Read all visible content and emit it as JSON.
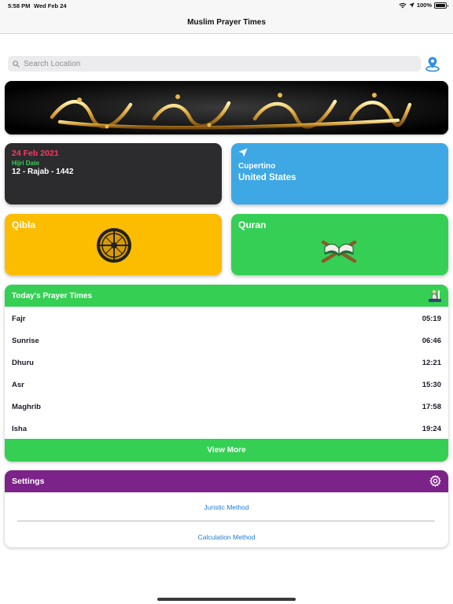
{
  "status_bar": {
    "time": "5:58 PM",
    "date": "Wed Feb 24",
    "battery": "100%"
  },
  "nav": {
    "title": "Muslim Prayer Times"
  },
  "search": {
    "placeholder": "Search Location"
  },
  "date_card": {
    "gregorian": "24 Feb 2021",
    "hijri_label": "Hijri Date",
    "hijri_value": "12 - Rajab - 1442"
  },
  "location_card": {
    "city": "Cupertino",
    "country": "United States"
  },
  "qibla_card": {
    "title": "Qibla"
  },
  "quran_card": {
    "title": "Quran"
  },
  "prayer_times": {
    "title": "Today's Prayer Times",
    "rows": [
      {
        "name": "Fajr",
        "time": "05:19"
      },
      {
        "name": "Sunrise",
        "time": "06:46"
      },
      {
        "name": "Dhuru",
        "time": "12:21"
      },
      {
        "name": "Asr",
        "time": "15:30"
      },
      {
        "name": "Maghrib",
        "time": "17:58"
      },
      {
        "name": "Isha",
        "time": "19:24"
      }
    ],
    "view_more": "View More"
  },
  "settings": {
    "title": "Settings",
    "items": [
      "Juristic Method",
      "Calculation Method"
    ]
  },
  "colors": {
    "green": "#35cf54",
    "purple": "#7b2389",
    "blue": "#3ea8e5",
    "yellow": "#fcbc00",
    "dark": "#2c2c2e",
    "date_red": "#ff375f",
    "link_blue": "#1c7bd8"
  },
  "icons": [
    "search-icon",
    "location-pin-icon",
    "navigation-arrow-icon",
    "compass-icon",
    "quran-book-icon",
    "mosque-prayer-icon",
    "gear-icon",
    "wifi-icon",
    "battery-icon"
  ]
}
